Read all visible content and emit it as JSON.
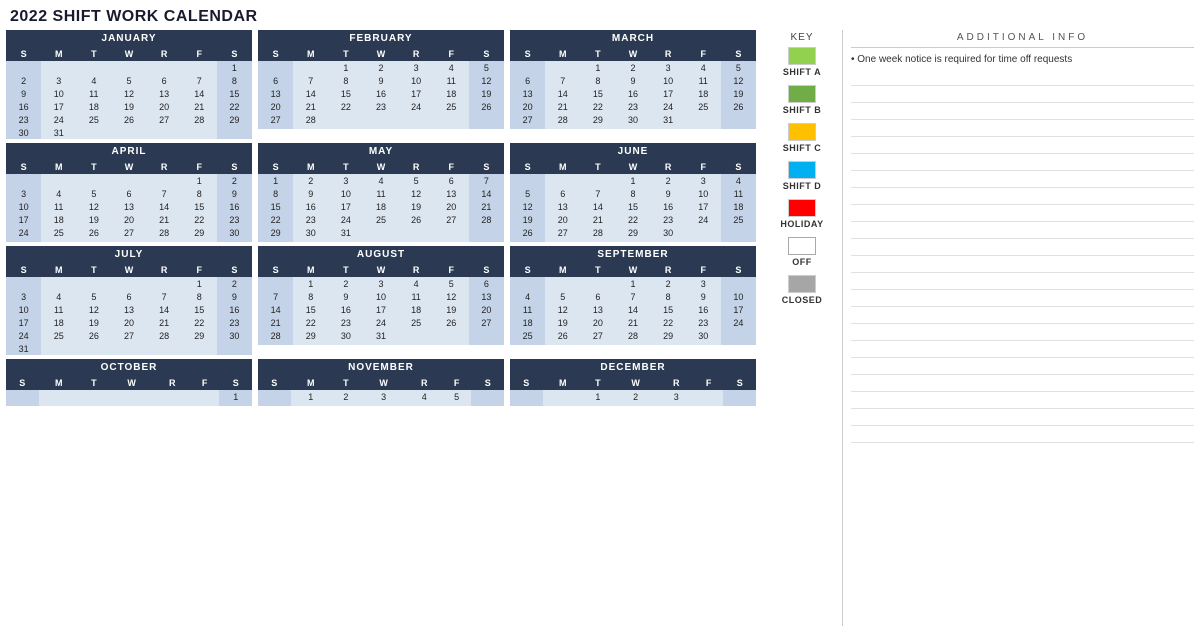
{
  "title": "2022 SHIFT WORK CALENDAR",
  "key": {
    "label": "KEY",
    "items": [
      {
        "label": "SHIFT A",
        "color": "#92d050"
      },
      {
        "label": "SHIFT B",
        "color": "#70ad47"
      },
      {
        "label": "SHIFT C",
        "color": "#ffc000"
      },
      {
        "label": "SHIFT D",
        "color": "#00b0f0"
      },
      {
        "label": "HOLIDAY",
        "color": "#ff0000"
      },
      {
        "label": "OFF",
        "color": "#ffffff"
      },
      {
        "label": "CLOSED",
        "color": "#a6a6a6"
      }
    ]
  },
  "additional_info": {
    "title": "ADDITIONAL INFO",
    "note": "• One week notice is required for time off requests",
    "info_line_count": 22
  },
  "months": [
    {
      "name": "JANUARY",
      "days": [
        "S",
        "M",
        "T",
        "W",
        "R",
        "F",
        "S"
      ],
      "weeks": [
        [
          "",
          "",
          "",
          "",
          "",
          "",
          "1"
        ],
        [
          "2",
          "3",
          "4",
          "5",
          "6",
          "7",
          "8"
        ],
        [
          "9",
          "10",
          "11",
          "12",
          "13",
          "14",
          "15"
        ],
        [
          "16",
          "17",
          "18",
          "19",
          "20",
          "21",
          "22"
        ],
        [
          "23",
          "24",
          "25",
          "26",
          "27",
          "28",
          "29"
        ],
        [
          "30",
          "31",
          "",
          "",
          "",
          "",
          ""
        ]
      ]
    },
    {
      "name": "FEBRUARY",
      "days": [
        "S",
        "M",
        "T",
        "W",
        "R",
        "F",
        "S"
      ],
      "weeks": [
        [
          "",
          "",
          "1",
          "2",
          "3",
          "4",
          "5"
        ],
        [
          "6",
          "7",
          "8",
          "9",
          "10",
          "11",
          "12"
        ],
        [
          "13",
          "14",
          "15",
          "16",
          "17",
          "18",
          "19"
        ],
        [
          "20",
          "21",
          "22",
          "23",
          "24",
          "25",
          "26"
        ],
        [
          "27",
          "28",
          "",
          "",
          "",
          "",
          ""
        ],
        [
          "",
          "",
          "",
          "",
          "",
          "",
          ""
        ]
      ]
    },
    {
      "name": "MARCH",
      "days": [
        "S",
        "M",
        "T",
        "W",
        "R",
        "F",
        "S"
      ],
      "weeks": [
        [
          "",
          "",
          "1",
          "2",
          "3",
          "4",
          "5"
        ],
        [
          "6",
          "7",
          "8",
          "9",
          "10",
          "11",
          "12"
        ],
        [
          "13",
          "14",
          "15",
          "16",
          "17",
          "18",
          "19"
        ],
        [
          "20",
          "21",
          "22",
          "23",
          "24",
          "25",
          "26"
        ],
        [
          "27",
          "28",
          "29",
          "30",
          "31",
          "",
          ""
        ],
        [
          "",
          "",
          "",
          "",
          "",
          "",
          ""
        ]
      ]
    },
    {
      "name": "APRIL",
      "days": [
        "S",
        "M",
        "T",
        "W",
        "R",
        "F",
        "S"
      ],
      "weeks": [
        [
          "",
          "",
          "",
          "",
          "",
          "1",
          "2"
        ],
        [
          "3",
          "4",
          "5",
          "6",
          "7",
          "8",
          "9"
        ],
        [
          "10",
          "11",
          "12",
          "13",
          "14",
          "15",
          "16"
        ],
        [
          "17",
          "18",
          "19",
          "20",
          "21",
          "22",
          "23"
        ],
        [
          "24",
          "25",
          "26",
          "27",
          "28",
          "29",
          "30"
        ],
        [
          "",
          "",
          "",
          "",
          "",
          "",
          ""
        ]
      ]
    },
    {
      "name": "MAY",
      "days": [
        "S",
        "M",
        "T",
        "W",
        "R",
        "F",
        "S"
      ],
      "weeks": [
        [
          "1",
          "2",
          "3",
          "4",
          "5",
          "6",
          "7"
        ],
        [
          "8",
          "9",
          "10",
          "11",
          "12",
          "13",
          "14"
        ],
        [
          "15",
          "16",
          "17",
          "18",
          "19",
          "20",
          "21"
        ],
        [
          "22",
          "23",
          "24",
          "25",
          "26",
          "27",
          "28"
        ],
        [
          "29",
          "30",
          "31",
          "",
          "",
          "",
          ""
        ],
        [
          "",
          "",
          "",
          "",
          "",
          "",
          ""
        ]
      ]
    },
    {
      "name": "JUNE",
      "days": [
        "S",
        "M",
        "T",
        "W",
        "R",
        "F",
        "S"
      ],
      "weeks": [
        [
          "",
          "",
          "",
          "1",
          "2",
          "3",
          "4"
        ],
        [
          "5",
          "6",
          "7",
          "8",
          "9",
          "10",
          "11"
        ],
        [
          "12",
          "13",
          "14",
          "15",
          "16",
          "17",
          "18"
        ],
        [
          "19",
          "20",
          "21",
          "22",
          "23",
          "24",
          "25"
        ],
        [
          "26",
          "27",
          "28",
          "29",
          "30",
          "",
          ""
        ],
        [
          "",
          "",
          "",
          "",
          "",
          "",
          ""
        ]
      ]
    },
    {
      "name": "JULY",
      "days": [
        "S",
        "M",
        "T",
        "W",
        "R",
        "F",
        "S"
      ],
      "weeks": [
        [
          "",
          "",
          "",
          "",
          "",
          "1",
          "2"
        ],
        [
          "3",
          "4",
          "5",
          "6",
          "7",
          "8",
          "9"
        ],
        [
          "10",
          "11",
          "12",
          "13",
          "14",
          "15",
          "16"
        ],
        [
          "17",
          "18",
          "19",
          "20",
          "21",
          "22",
          "23"
        ],
        [
          "24",
          "25",
          "26",
          "27",
          "28",
          "29",
          "30"
        ],
        [
          "31",
          "",
          "",
          "",
          "",
          "",
          ""
        ]
      ]
    },
    {
      "name": "AUGUST",
      "days": [
        "S",
        "M",
        "T",
        "W",
        "R",
        "F",
        "S"
      ],
      "weeks": [
        [
          "",
          "1",
          "2",
          "3",
          "4",
          "5",
          "6"
        ],
        [
          "7",
          "8",
          "9",
          "10",
          "11",
          "12",
          "13"
        ],
        [
          "14",
          "15",
          "16",
          "17",
          "18",
          "19",
          "20"
        ],
        [
          "21",
          "22",
          "23",
          "24",
          "25",
          "26",
          "27"
        ],
        [
          "28",
          "29",
          "30",
          "31",
          "",
          "",
          ""
        ],
        [
          "",
          "",
          "",
          "",
          "",
          "",
          ""
        ]
      ]
    },
    {
      "name": "SEPTEMBER",
      "days": [
        "S",
        "M",
        "T",
        "W",
        "R",
        "F",
        "S"
      ],
      "weeks": [
        [
          "",
          "",
          "",
          "1",
          "2",
          "3",
          ""
        ],
        [
          "4",
          "5",
          "6",
          "7",
          "8",
          "9",
          "10"
        ],
        [
          "11",
          "12",
          "13",
          "14",
          "15",
          "16",
          "17"
        ],
        [
          "18",
          "19",
          "20",
          "21",
          "22",
          "23",
          "24"
        ],
        [
          "25",
          "26",
          "27",
          "28",
          "29",
          "30",
          ""
        ],
        [
          "",
          "",
          "",
          "",
          "",
          "",
          ""
        ]
      ]
    },
    {
      "name": "OCTOBER",
      "days": [
        "S",
        "M",
        "T",
        "W",
        "R",
        "F",
        "S"
      ],
      "weeks": [
        [
          "",
          "",
          "",
          "",
          "",
          "",
          "1"
        ],
        [
          "",
          "",
          "",
          "",
          "",
          "",
          ""
        ]
      ]
    },
    {
      "name": "NOVEMBER",
      "days": [
        "S",
        "M",
        "T",
        "W",
        "R",
        "F",
        "S"
      ],
      "weeks": [
        [
          "",
          "1",
          "2",
          "3",
          "4",
          "5",
          ""
        ],
        [
          "",
          "",
          "",
          "",
          "",
          "",
          ""
        ]
      ]
    },
    {
      "name": "DECEMBER",
      "days": [
        "S",
        "M",
        "T",
        "W",
        "R",
        "F",
        "S"
      ],
      "weeks": [
        [
          "",
          "",
          "1",
          "2",
          "3",
          "",
          ""
        ],
        [
          "",
          "",
          "",
          "",
          "",
          "",
          ""
        ]
      ]
    }
  ]
}
